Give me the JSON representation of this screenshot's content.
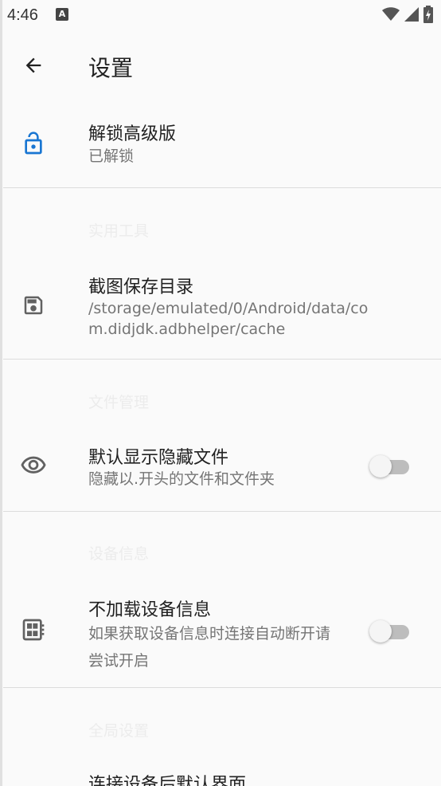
{
  "status_bar": {
    "time": "4:46",
    "notification_letter": "A",
    "icons": [
      "wifi-icon",
      "cell-signal-icon",
      "battery-charging-icon"
    ]
  },
  "toolbar": {
    "title": "设置",
    "back_icon": "arrow-back-icon"
  },
  "rows": {
    "unlock": {
      "title": "解锁高级版",
      "summary": "已解锁",
      "icon": "lock-icon",
      "color": "#1976d2"
    },
    "screenshot_dir": {
      "title": "截图保存目录",
      "summary": "/storage/emulated/0/Android/data/com.didjdk.adbhelper/cache",
      "icon": "save-icon"
    },
    "show_hidden": {
      "title": "默认显示隐藏文件",
      "summary": "隐藏以.开头的文件和文件夹",
      "icon": "eye-icon",
      "switch_on": false
    },
    "no_device_info": {
      "title": "不加载设备信息",
      "summary": "如果获取设备信息时连接自动断开请尝试开启",
      "icon": "chip-icon",
      "switch_on": false
    },
    "default_page": {
      "title": "连接设备后默认界面"
    }
  },
  "categories": {
    "tools": "实用工具",
    "file_mgmt": "文件管理",
    "device_info": "设备信息",
    "global": "全局设置"
  },
  "colors": {
    "accent": "#1976d2",
    "icon_gray": "#616161",
    "divider": "#dcdcdc"
  }
}
